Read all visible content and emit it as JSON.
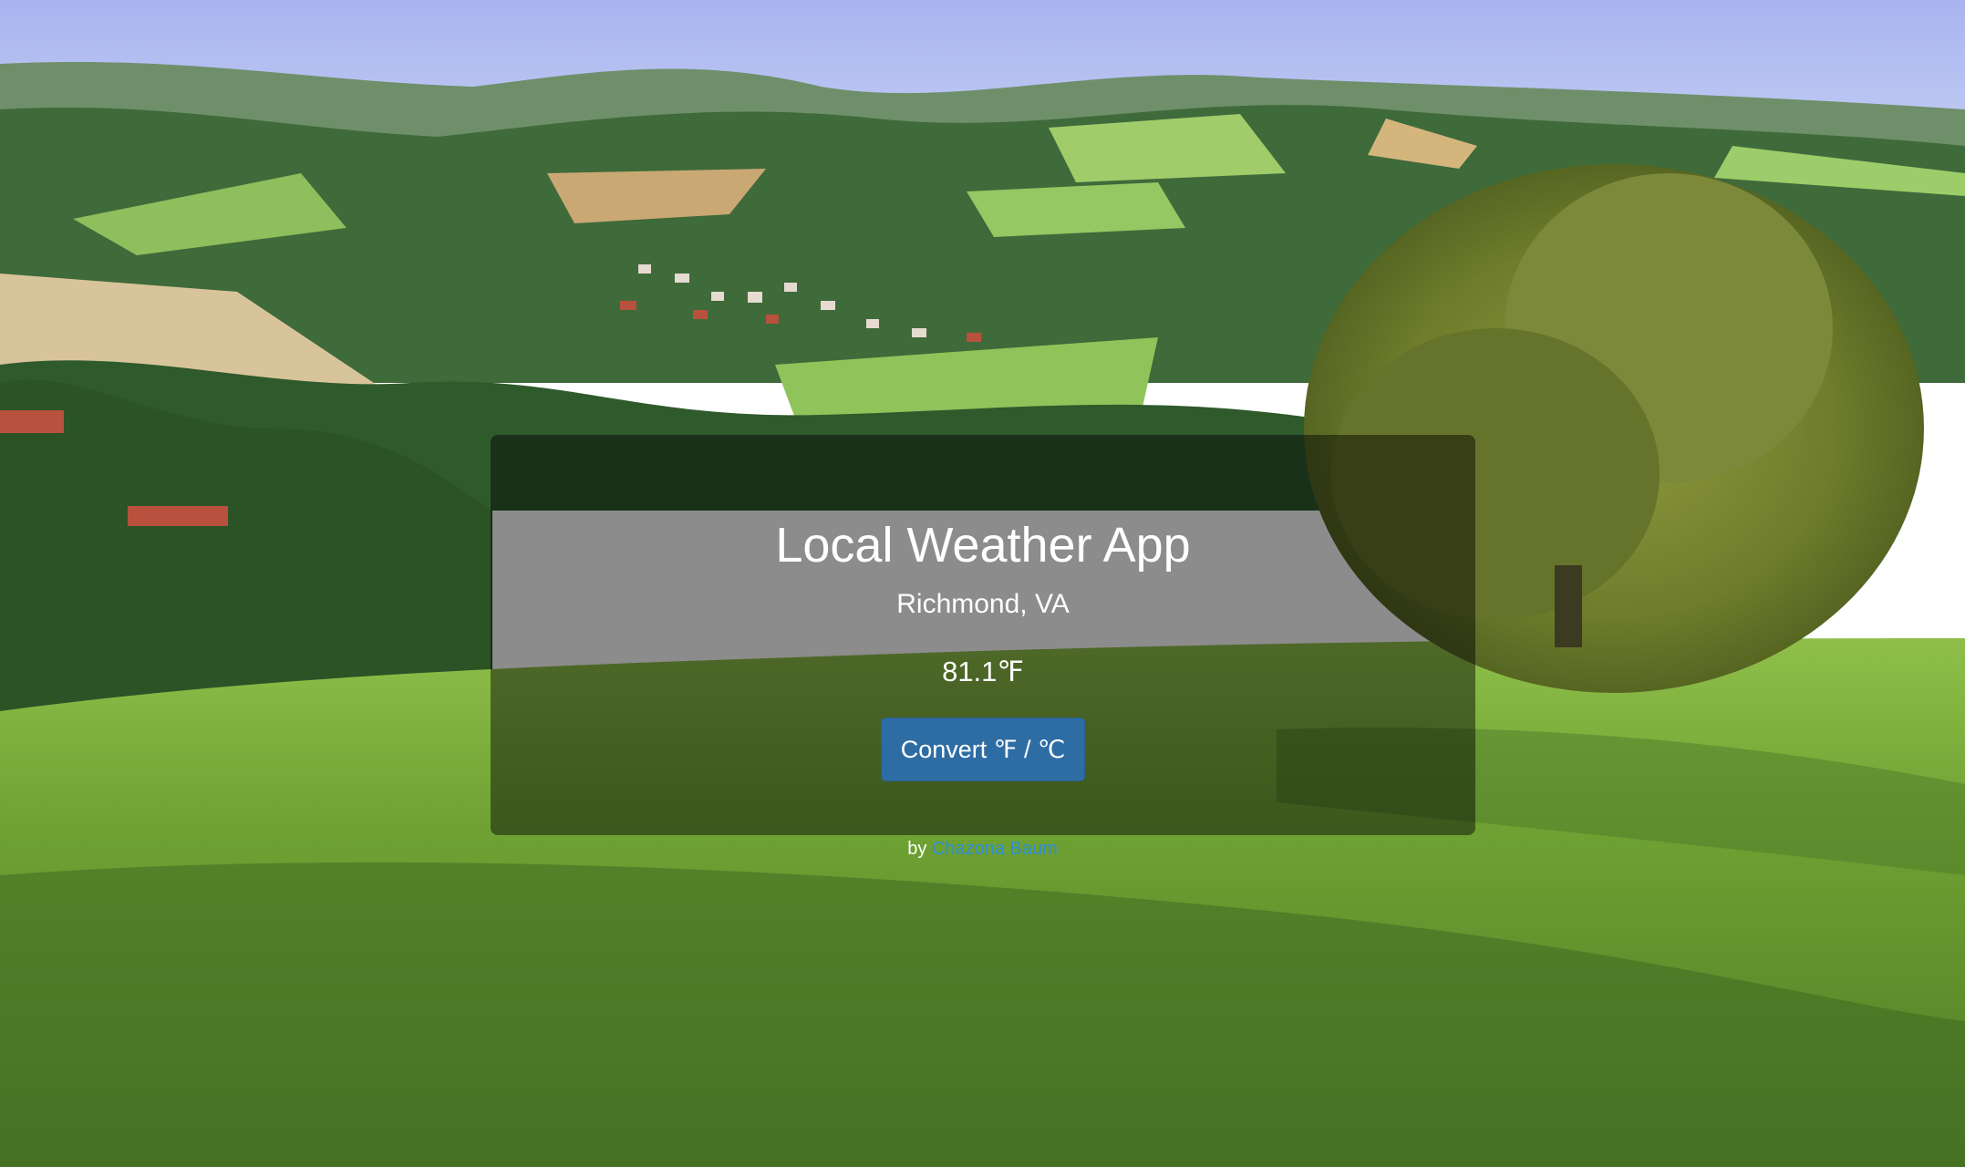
{
  "app": {
    "title": "Local Weather App",
    "location": "Richmond, VA",
    "temperature": "81.1℉"
  },
  "actions": {
    "convert_label": "Convert ℉ / ℃"
  },
  "footer": {
    "by_text": "by",
    "author_link": "Chazona Baum"
  },
  "colors": {
    "button": "#2e6da4",
    "link": "#2f8fd6",
    "card_overlay": "rgba(0,0,0,0.45)"
  }
}
